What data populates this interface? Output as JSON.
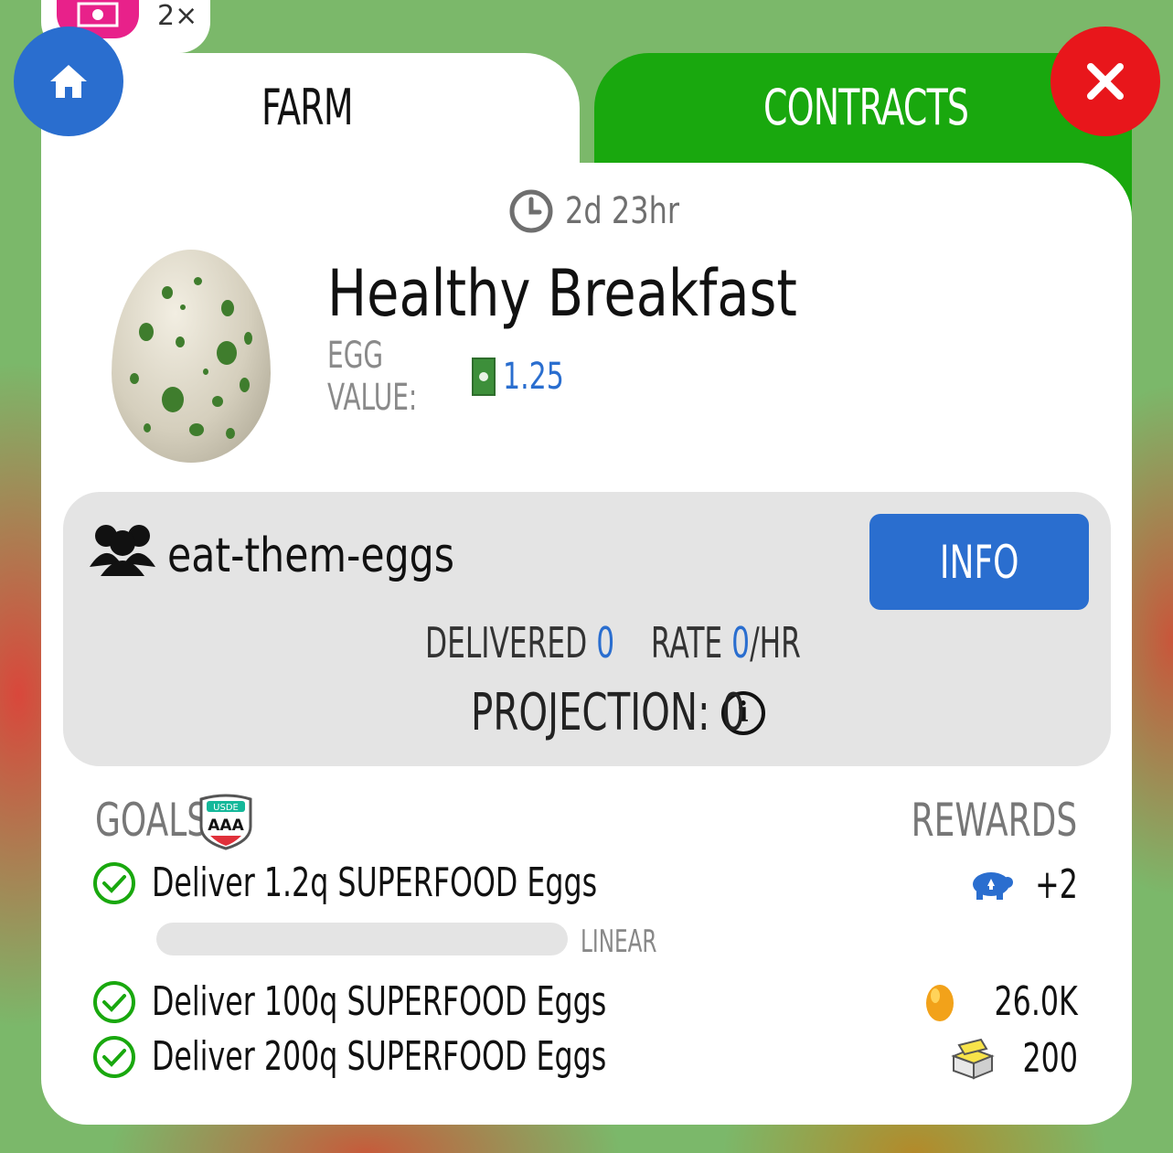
{
  "header": {
    "multiplier": "2×",
    "tabs": [
      {
        "label": "FARM",
        "active": true
      },
      {
        "label": "CONTRACTS",
        "active": false
      }
    ]
  },
  "contract": {
    "time_remaining": "2d 23hr",
    "title": "Healthy Breakfast",
    "egg_value_label": "EGG VALUE:",
    "egg_value": "1.25"
  },
  "coop": {
    "name": "eat-them-eggs",
    "info_label": "INFO",
    "delivered_label": "DELIVERED",
    "delivered_value": "0",
    "rate_label": "RATE",
    "rate_value": "0",
    "rate_unit": "/HR",
    "projection": "PROJECTION: 0"
  },
  "goals": {
    "goals_label": "GOALS",
    "rewards_label": "REWARDS",
    "badge_text": "AAA",
    "badge_top": "USDE",
    "items": [
      {
        "text": "Deliver 1.2q SUPERFOOD Eggs",
        "reward": "+2",
        "reward_icon": "piggy-bank-icon",
        "progress": 0,
        "progress_label": "LINEAR"
      },
      {
        "text": "Deliver 100q SUPERFOOD Eggs",
        "reward": "26.0K",
        "reward_icon": "golden-egg-icon"
      },
      {
        "text": "Deliver 200q SUPERFOOD Eggs",
        "reward": "200",
        "reward_icon": "supply-crate-icon"
      }
    ]
  },
  "colors": {
    "accent_blue": "#2a6ecf",
    "accent_green": "#19a80e",
    "close_red": "#e8161b",
    "cash_pink": "#e8218a"
  }
}
